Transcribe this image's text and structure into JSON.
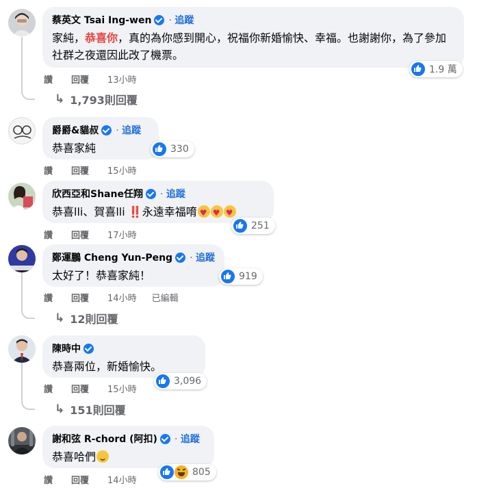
{
  "comments": [
    {
      "name": "蔡英文 Tsai Ing-wen",
      "follow": "追蹤",
      "text_pre": "家純，",
      "text_hl": "恭喜你",
      "text_post": "，真的為你感到開心，祝福你新婚愉快、幸福。也謝謝你，為了參加社群之夜還因此改了機票。",
      "like": "讚",
      "reply": "回覆",
      "time": "13小時",
      "reactions": "1.9 萬",
      "replies": "1,793則回覆"
    },
    {
      "name": "爵爵&貓叔",
      "follow": "追蹤",
      "text": "恭喜家純",
      "like": "讚",
      "reply": "回覆",
      "time": "15小時",
      "reactions": "330"
    },
    {
      "name": "欣西亞和Shane任翔",
      "follow": "追蹤",
      "text_a": "恭喜lli、賀喜lli ",
      "text_b": "‼️",
      "text_c": "永遠幸福唷",
      "like": "讚",
      "reply": "回覆",
      "time": "17小時",
      "reactions": "251"
    },
    {
      "name": "鄭運鵬 Cheng Yun-Peng",
      "follow": "追蹤",
      "text": "太好了！恭喜家純！",
      "like": "讚",
      "reply": "回覆",
      "time": "14小時",
      "edited": "已編輯",
      "reactions": "919",
      "replies": "12則回覆"
    },
    {
      "name": "陳時中",
      "text": "恭喜兩位，新婚愉快。",
      "like": "讚",
      "reply": "回覆",
      "time": "15小時",
      "reactions": "3,096",
      "replies": "151則回覆"
    },
    {
      "name": "謝和弦 R-chord (阿扣)",
      "follow": "追蹤",
      "text": "恭喜哈們",
      "like": "讚",
      "reply": "回覆",
      "time": "14小時",
      "reactions": "805"
    }
  ],
  "colors": {
    "link_blue": "#216fdb",
    "highlight_red": "#e9423e",
    "bubble_bg": "#f0f2f5",
    "meta_gray": "#65676b",
    "like_blue": "#1877f2"
  },
  "icons": [
    "verified-badge-icon",
    "like-reaction-icon",
    "haha-reaction-icon",
    "reply-arrow-icon"
  ]
}
